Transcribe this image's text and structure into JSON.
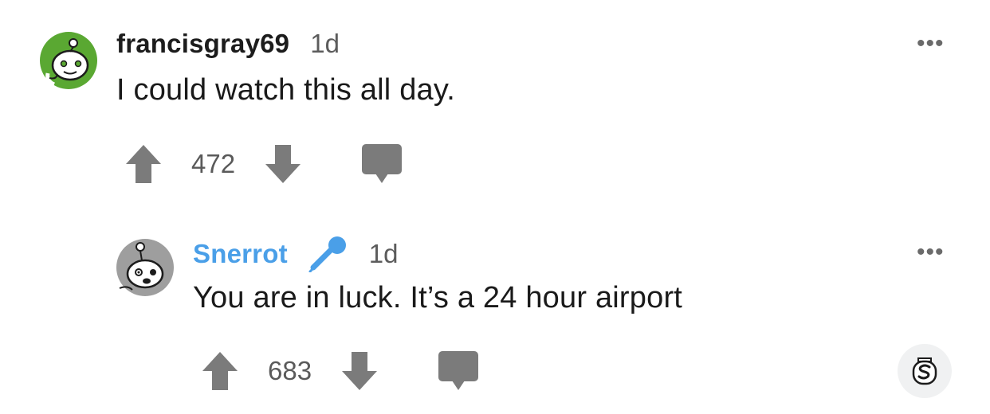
{
  "comments": [
    {
      "username": "francisgray69",
      "time": "1d",
      "text": "I could watch this all day.",
      "votes": "472",
      "avatar_color": "#5aa832"
    },
    {
      "username": "Snerrot",
      "time": "1d",
      "text": "You are in luck. It’s a 24 hour airport",
      "votes": "683",
      "username_color": "#4a9fe8",
      "avatar_color": "#9e9e9e",
      "flair_icon": "microphone-icon"
    }
  ],
  "more_label": "•••",
  "icons": {
    "upvote": "arrow-up-icon",
    "downvote": "arrow-down-icon",
    "reply": "speech-bubble-icon",
    "award": "award-icon"
  },
  "colors": {
    "icon_gray": "#7b7b7b",
    "award_bg": "#f0f1f2"
  }
}
